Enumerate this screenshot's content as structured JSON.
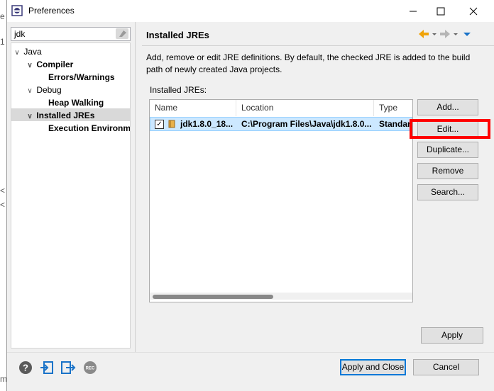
{
  "background": {
    "left_glyphs": [
      "e",
      "1",
      "<",
      "<",
      "m"
    ]
  },
  "window": {
    "title": "Preferences",
    "controls": {
      "minimize": "—",
      "maximize": "☐",
      "close": "✕"
    }
  },
  "filter": {
    "value": "jdk"
  },
  "tree": {
    "items": [
      {
        "label": "Java",
        "expanded": true
      },
      {
        "label": "Compiler",
        "expanded": true
      },
      {
        "label": "Errors/Warnings"
      },
      {
        "label": "Debug",
        "expanded": true
      },
      {
        "label": "Heap Walking"
      },
      {
        "label": "Installed JREs",
        "expanded": true,
        "selected": true
      },
      {
        "label": "Execution Environme"
      }
    ]
  },
  "page": {
    "heading": "Installed JREs",
    "description": "Add, remove or edit JRE definitions. By default, the checked JRE is added to the build path of newly created Java projects.",
    "table_label": "Installed JREs:",
    "columns": [
      "Name",
      "Location",
      "Type"
    ],
    "rows": [
      {
        "checked": true,
        "name": "jdk1.8.0_18...",
        "location": "C:\\Program Files\\Java\\jdk1.8.0...",
        "type": "Standar"
      }
    ]
  },
  "buttons": {
    "add": "Add...",
    "edit": "Edit...",
    "duplicate": "Duplicate...",
    "remove": "Remove",
    "search": "Search...",
    "apply": "Apply",
    "apply_close": "Apply and Close",
    "cancel": "Cancel"
  },
  "colors": {
    "accent": "#0078d7",
    "highlight": "#ff0000",
    "selection": "#cce8ff"
  }
}
